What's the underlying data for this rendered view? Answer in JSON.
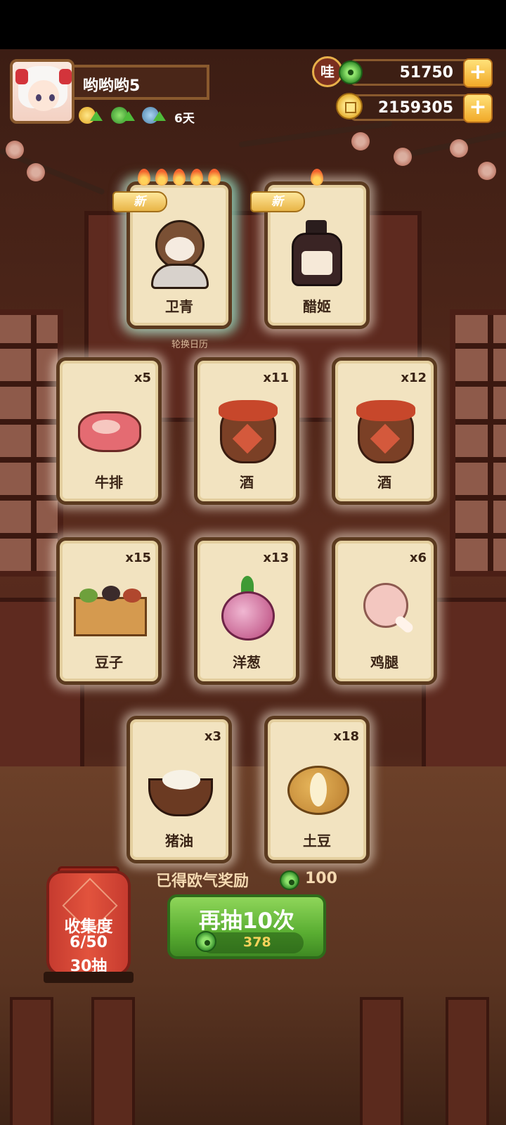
{
  "player": {
    "name": "哟哟哟5",
    "days": "6天"
  },
  "resources": {
    "wa_badge": "哇",
    "jade": "51750",
    "coins": "2159305",
    "plus": "+"
  },
  "featured_cards": [
    {
      "name": "卫青",
      "tag": "新",
      "flames": 5,
      "count": ""
    },
    {
      "name": "醋姬",
      "tag": "新",
      "flames": 1,
      "count": ""
    }
  ],
  "calendar_hint": "轮换日历",
  "item_cards": [
    {
      "name": "牛排",
      "count": "x5"
    },
    {
      "name": "酒",
      "count": "x11"
    },
    {
      "name": "酒",
      "count": "x12"
    },
    {
      "name": "豆子",
      "count": "x15"
    },
    {
      "name": "洋葱",
      "count": "x13"
    },
    {
      "name": "鸡腿",
      "count": "x6"
    },
    {
      "name": "猪油",
      "count": "x3"
    },
    {
      "name": "土豆",
      "count": "x18"
    }
  ],
  "reward": {
    "label": "已得欧气奖励",
    "value": "100"
  },
  "draw_button": {
    "label": "再抽10次",
    "cost": "378"
  },
  "collection": {
    "title": "收集度",
    "progress": "6/50",
    "pulls": "30抽"
  },
  "colors": {
    "accent_green": "#5aae32",
    "gold": "#f1a928",
    "lantern_red": "#d9473a",
    "card_bg": "#f2e3c0"
  }
}
